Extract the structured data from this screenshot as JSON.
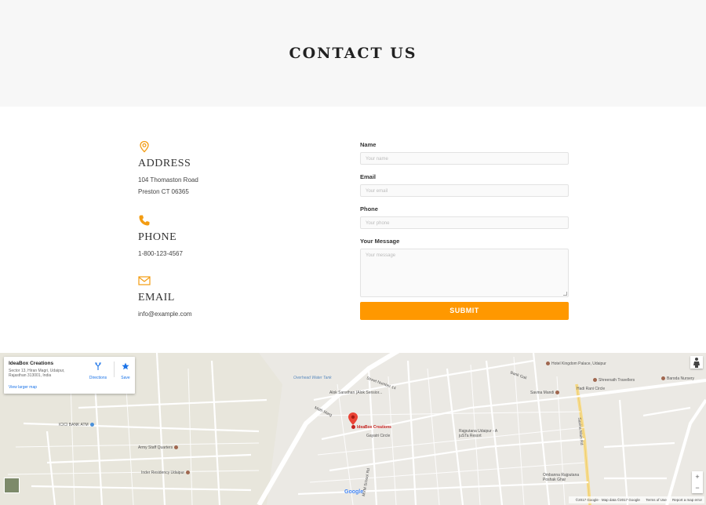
{
  "hero": {
    "title": "CONTACT US"
  },
  "contact": {
    "address": {
      "heading": "ADDRESS",
      "line1": "104 Thomaston Road",
      "line2": "Preston CT 06365"
    },
    "phone": {
      "heading": "PHONE",
      "value": "1-800-123-4567"
    },
    "email": {
      "heading": "EMAIL",
      "value": "info@example.com"
    },
    "accent_color": "#f39c12"
  },
  "form": {
    "name_label": "Name",
    "name_placeholder": "Your name",
    "email_label": "Email",
    "email_placeholder": "Your email",
    "phone_label": "Phone",
    "phone_placeholder": "Your phone",
    "message_label": "Your Message",
    "message_placeholder": "Your message",
    "submit_label": "SUBMIT",
    "submit_color": "#ff9800"
  },
  "map": {
    "card": {
      "name": "IdeaBox Creations",
      "address": "Sector 13, Hiran Magri, Udaipur, Rajasthan 313001, India",
      "directions_label": "Directions",
      "save_label": "Save",
      "larger_map_label": "View larger map"
    },
    "labels": {
      "hotel": "Hotel Kingdom Palace, Udaipur",
      "travellers": "Shreenath Travellers",
      "nursery": "Baroda Nursery",
      "savina": "Savina Mandi",
      "hadi_rani": "Hadi Rani Circle",
      "overhead": "Overhead Water Tank",
      "alok": "Alok Sansthan (Alok Sensior...",
      "street": "Street Number 14",
      "bank_gali": "Bank Gali",
      "math_marg": "Math Marg",
      "ideabox": "IdeaBox Creations",
      "gayatri": "Gayatri Circle",
      "icici": "ICICI BANK ATM",
      "army": "Army Staff Quarters",
      "inder": "Inder Residency Udaipur",
      "rajputana": "Rajputana Udaipur - A juSTa Resort",
      "savina_main": "Savina Main Rd",
      "school": "MVM School Rd",
      "ombanna": "Ombanna Rajputana Poshak Ghar"
    },
    "zoom_in": "+",
    "zoom_out": "−",
    "google": "Google",
    "attribution": {
      "copyright": "©2017 Google · Map data ©2017 Google",
      "terms": "Terms of Use",
      "report": "Report a map error"
    }
  }
}
